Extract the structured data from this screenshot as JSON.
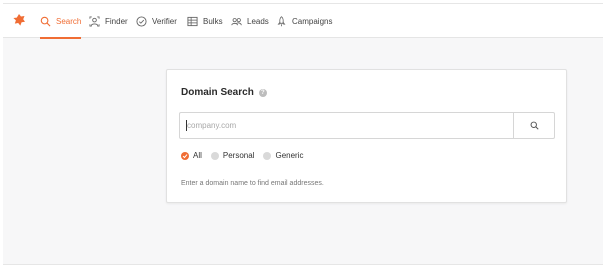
{
  "nav": {
    "items": [
      {
        "label": "Search",
        "icon": "search-icon",
        "active": true
      },
      {
        "label": "Finder",
        "icon": "finder-icon",
        "active": false
      },
      {
        "label": "Verifier",
        "icon": "verifier-icon",
        "active": false
      },
      {
        "label": "Bulks",
        "icon": "bulks-icon",
        "active": false
      },
      {
        "label": "Leads",
        "icon": "leads-icon",
        "active": false
      },
      {
        "label": "Campaigns",
        "icon": "campaigns-icon",
        "active": false
      }
    ]
  },
  "panel": {
    "title": "Domain Search",
    "search_placeholder": "company.com",
    "search_value": "",
    "filters": [
      {
        "label": "All",
        "checked": true
      },
      {
        "label": "Personal",
        "checked": false
      },
      {
        "label": "Generic",
        "checked": false
      }
    ],
    "helper_text": "Enter a domain name to find email addresses."
  },
  "colors": {
    "accent": "#f06d34",
    "background": "#f7f7f8",
    "panel": "#ffffff"
  }
}
